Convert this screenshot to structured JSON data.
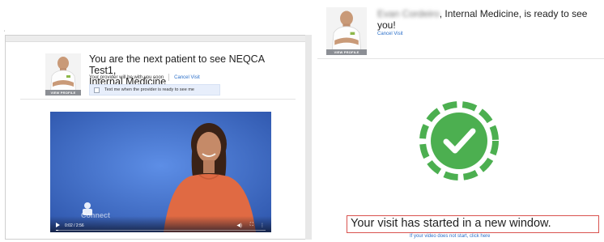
{
  "left": {
    "title_line1": "You are the next patient to see NEQCA Test1,",
    "title_line2": "Internal Medicine",
    "status": "Your provider will be with you soon",
    "cancel_label": "Cancel Visit",
    "text_me_label": "Text me when the provider is ready to see me",
    "avatar_caption": "VIEW PROFILE",
    "video": {
      "time": "0:02 / 2:56",
      "progress_fraction": 0.012
    }
  },
  "right": {
    "blurred_name": "Evan Cordeiro",
    "title_rest": ", Internal Medicine, is ready to see",
    "title_line2": "you!",
    "cancel_label": "Cancel Visit",
    "avatar_caption": "VIEW PROFILE",
    "started_text": "Your visit has started in a new window.",
    "click_here_text": "If your video does not start, click here"
  },
  "colors": {
    "link": "#2a6fc9",
    "status_green": "#4caf50",
    "alert_red": "#d9534f",
    "video_bg": "#3f6dc8"
  }
}
